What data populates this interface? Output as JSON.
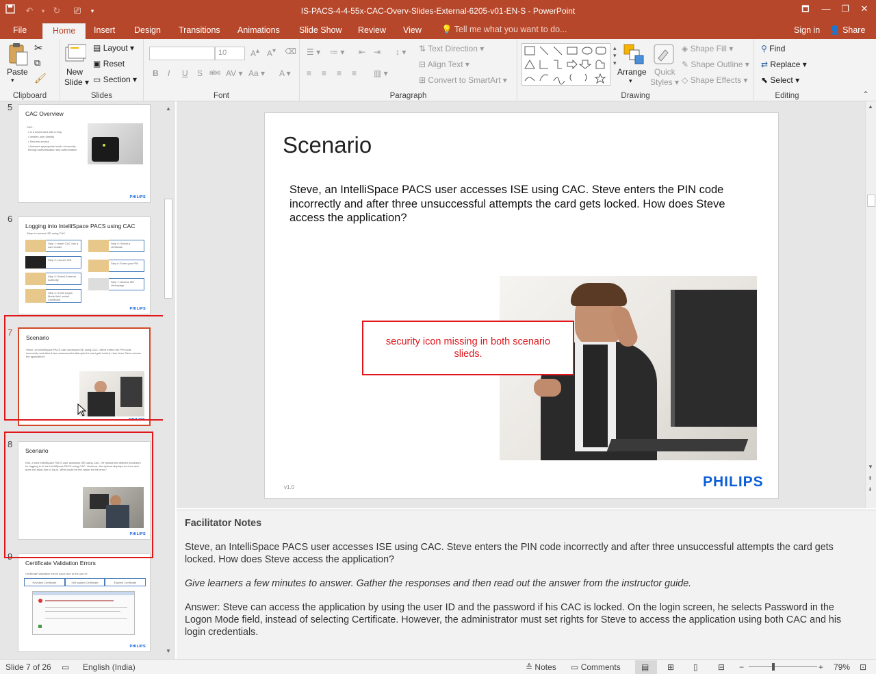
{
  "window": {
    "title": "IS-PACS-4-4-55x-CAC-Overv-Slides-External-6205-v01-EN-S - PowerPoint",
    "qat_icons": [
      "save-icon",
      "undo-icon",
      "redo-icon",
      "start-from-beginning-icon",
      "customize-qat-icon"
    ],
    "controls": {
      "ribbon_options": "🗖",
      "minimize": "—",
      "restore": "❐",
      "close": "✕"
    }
  },
  "tabs": {
    "file": "File",
    "home": "Home",
    "insert": "Insert",
    "design": "Design",
    "transitions": "Transitions",
    "animations": "Animations",
    "slideshow": "Slide Show",
    "review": "Review",
    "view": "View",
    "tellme": "Tell me what you want to do...",
    "signin": "Sign in",
    "share": "Share"
  },
  "ribbon": {
    "clipboard": {
      "label": "Clipboard",
      "paste": "Paste"
    },
    "slides": {
      "label": "Slides",
      "new_slide_1": "New",
      "new_slide_2": "Slide",
      "layout": "Layout",
      "reset": "Reset",
      "section": "Section"
    },
    "font": {
      "label": "Font",
      "font_name": "",
      "font_size": "10"
    },
    "paragraph": {
      "label": "Paragraph",
      "text_direction": "Text Direction",
      "align_text": "Align Text",
      "convert": "Convert to SmartArt"
    },
    "drawing": {
      "label": "Drawing",
      "arrange": "Arrange",
      "quick_styles_1": "Quick",
      "quick_styles_2": "Styles",
      "shape_fill": "Shape Fill",
      "shape_outline": "Shape Outline",
      "shape_effects": "Shape Effects"
    },
    "editing": {
      "label": "Editing",
      "find": "Find",
      "replace": "Replace",
      "select": "Select"
    }
  },
  "thumbnails": [
    {
      "num": "5",
      "title": "CAC Overview",
      "lines": [
        "CAC:",
        "• Is a smart card with a chip",
        "• Verifies user identity",
        "• Secures access",
        "• Answers appropriate levels of security through authentication and authorization"
      ]
    },
    {
      "num": "6",
      "title": "Logging into IntelliSpace PACS using CAC",
      "subtitle": "Steps to access ISE using CAC:",
      "steps": [
        "Step 1: Insert CAC into a card reader",
        "Step 2: Launch ISE",
        "Step 3: Select External Authority",
        "Step 4: In the Logon Mode field, select Certificate",
        "Step 5: Select a certificate",
        "Step 6: Enter your PIN",
        "Step 7: Access ISE Homepage"
      ]
    },
    {
      "num": "7",
      "title": "Scenario",
      "body": "Steve, an IntelliSpace PACS user accesses ISE using CAC. Steve enters the PIN code incorrectly and after three unsuccessful attempts the card gets locked. How does Steve access the application?"
    },
    {
      "num": "8",
      "title": "Scenario",
      "body": "Rob, a new IntelliSpace PACS user accesses ISE using CAC. He follows the defined procedure for logging in to the IntelliSpace PACS using CAC. However, the system displays an error and does not allow him to log in. What could be the cause for the error?"
    },
    {
      "num": "9",
      "title": "Certificate Validation Errors",
      "subtitle": "Certificate Validation errors occur due to the use of:",
      "tabs": [
        "Revoked Certificate",
        "Self-signed Certificate",
        "Expired Certificate"
      ]
    }
  ],
  "thumb_logo": "PHILIPS",
  "slide": {
    "title": "Scenario",
    "body": "Steve, an IntelliSpace PACS user accesses ISE using CAC. Steve enters the PIN code incorrectly and after three unsuccessful attempts the card gets locked. How does Steve access the application?",
    "callout": "security icon missing in both scenario slieds.",
    "version": "v1.0",
    "logo": "PHILIPS"
  },
  "notes": {
    "heading": "Facilitator Notes",
    "p1": "Steve, an IntelliSpace PACS user accesses ISE using CAC. Steve enters the PIN code incorrectly and after three unsuccessful attempts the card gets locked. How does Steve access the application?",
    "p2": "Give learners a few minutes to answer. Gather the responses and then read out the answer from the instructor guide.",
    "p3": "Answer: Steve can access the application by using the user ID and the password if his CAC is locked. On the login screen, he selects Password in the Logon Mode field, instead of selecting Certificate. However, the administrator must set rights for Steve to access the application using both CAC and his login credentials."
  },
  "status": {
    "slide_count": "Slide 7 of 26",
    "language": "English (India)",
    "notes": "Notes",
    "comments": "Comments",
    "zoom": "79%"
  },
  "colors": {
    "accent": "#b7472a",
    "annotation": "#e0161b",
    "philips": "#0b5ed7"
  }
}
